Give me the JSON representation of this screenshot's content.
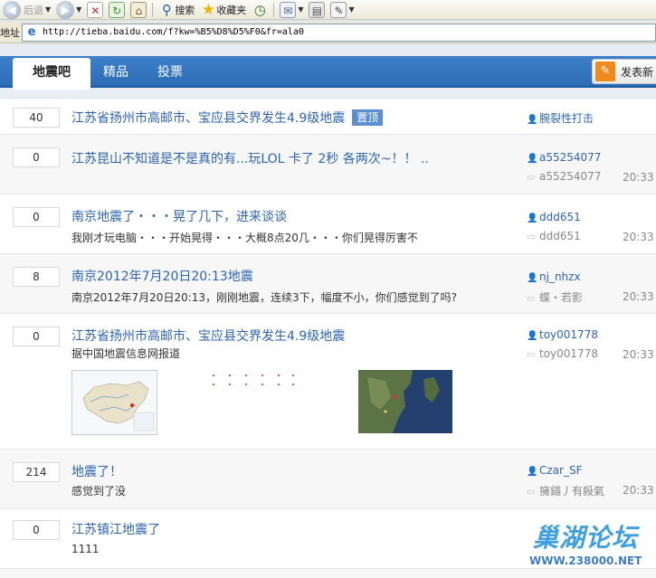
{
  "toolbar": {
    "back_label": "后退",
    "search_label": "搜索",
    "favorites_label": "收藏夹"
  },
  "addressbar": {
    "label": "地址",
    "url": "http://tieba.baidu.com/f?kw=%B5%D8%D5%F0&fr=ala0"
  },
  "tabs": [
    {
      "label": "地震吧",
      "active": true
    },
    {
      "label": "精品",
      "active": false
    },
    {
      "label": "投票",
      "active": false
    }
  ],
  "post_button_label": "发表新",
  "threads": [
    {
      "count": "40",
      "title": "江苏省扬州市高邮市、宝应县交界发生4.9级地震",
      "badge": "置顶",
      "abstract": "",
      "author": "腕裂性打击",
      "last_replier": "",
      "time": ""
    },
    {
      "count": "0",
      "title": "江苏昆山不知道是不是真的有...玩LOL 卡了  2秒  各两次~！！ ..",
      "badge": "",
      "abstract": "",
      "author": "a55254077",
      "last_replier": "a55254077",
      "time": "20:33"
    },
    {
      "count": "0",
      "title": "南京地震了・・・晃了几下，进来谈谈",
      "badge": "",
      "abstract": "我刚才玩电脑・・・开始晃得・・・大概8点20几・・・你们晃得厉害不",
      "author": "ddd651",
      "last_replier": "ddd651",
      "time": "20:33"
    },
    {
      "count": "8",
      "title": "南京2012年7月20日20:13地震",
      "badge": "",
      "abstract": "南京2012年7月20日20:13，刚刚地震，连续3下，幅度不小，你们感觉到了吗?",
      "author": "nj_nhzx",
      "last_replier": "蝶・若影",
      "time": "20:33"
    },
    {
      "count": "0",
      "title": "江苏省扬州市高邮市、宝应县交界发生4.9级地震",
      "badge": "",
      "abstract": "据中国地震信息网报道",
      "author": "toy001778",
      "last_replier": "toy001778",
      "time": "20:33"
    },
    {
      "count": "214",
      "title": "地震了！",
      "badge": "",
      "abstract": "感觉到了没",
      "author": "Czar_SF",
      "last_replier": "擁錨丿有殺氣",
      "time": "20:33"
    },
    {
      "count": "0",
      "title": "江苏镇江地震了",
      "badge": "",
      "abstract": "1111",
      "author": "",
      "last_replier": "",
      "time": ""
    }
  ],
  "watermark": {
    "title": "巢湖论坛",
    "url": "WWW.238000.NET"
  }
}
